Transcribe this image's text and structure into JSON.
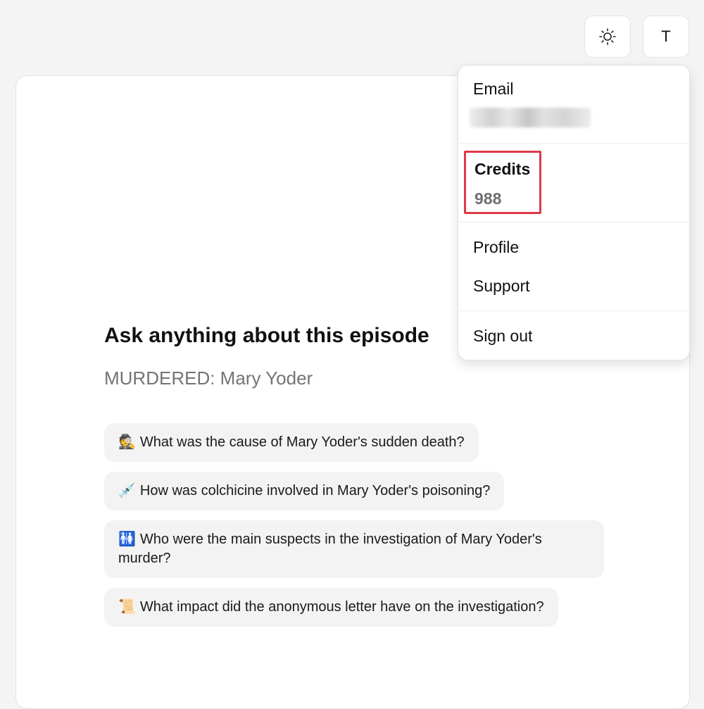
{
  "header": {
    "theme_icon": "sun-icon",
    "avatar_letter": "T"
  },
  "episode": {
    "title": "Ask anything about this episode",
    "subtitle": "MURDERED: Mary Yoder"
  },
  "questions": [
    {
      "emoji": "🕵️",
      "text": "What was the cause of Mary Yoder's sudden death?"
    },
    {
      "emoji": "💉",
      "text": "How was colchicine involved in Mary Yoder's poisoning?"
    },
    {
      "emoji": "🚻",
      "text": "Who were the main suspects in the investigation of Mary Yoder's murder?"
    },
    {
      "emoji": "📜",
      "text": "What impact did the anonymous letter have on the investigation?"
    }
  ],
  "menu": {
    "email_label": "Email",
    "credits_label": "Credits",
    "credits_value": "988",
    "profile": "Profile",
    "support": "Support",
    "sign_out": "Sign out"
  },
  "colors": {
    "highlight": "#e03848",
    "background": "#f4f4f4"
  }
}
